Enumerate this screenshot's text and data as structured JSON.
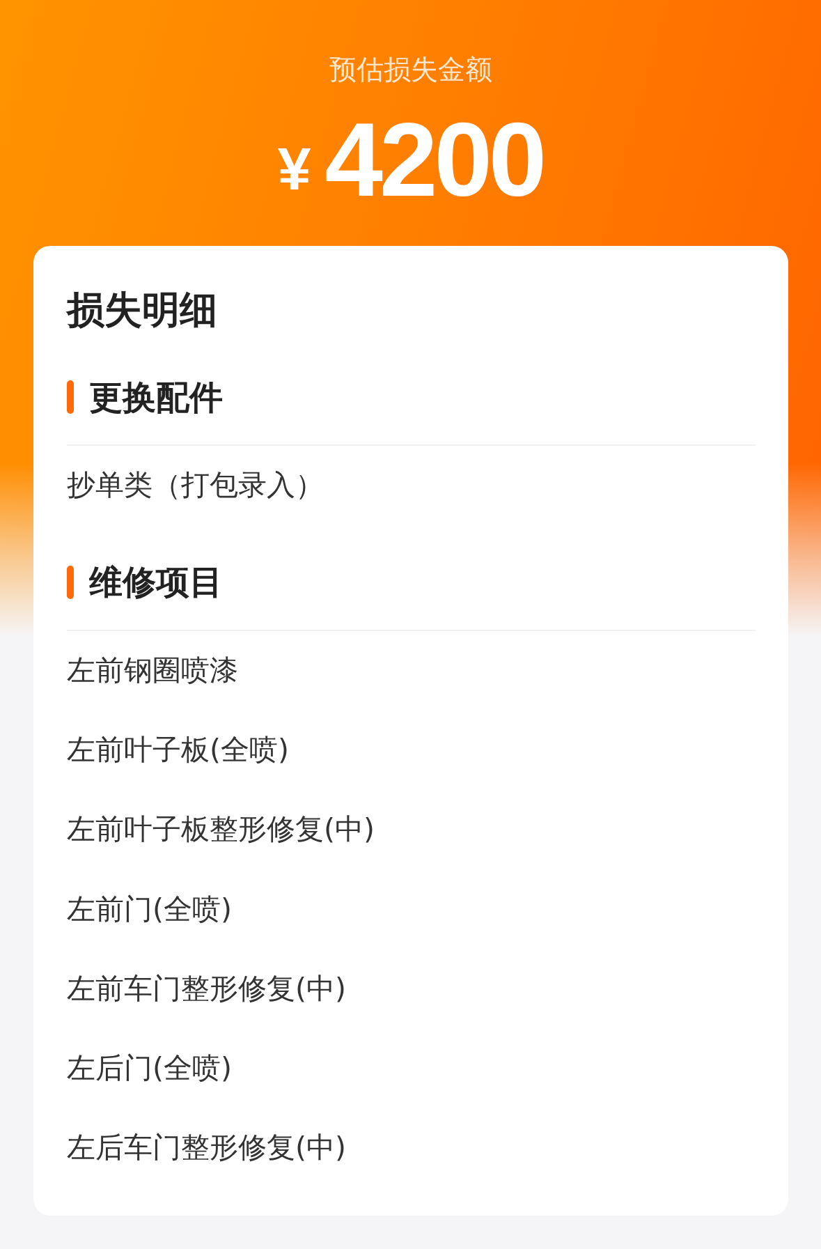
{
  "header": {
    "label": "预估损失金额",
    "currency": "¥",
    "amount": "4200"
  },
  "card": {
    "title": "损失明细",
    "sections": [
      {
        "title": "更换配件",
        "items": [
          "抄单类（打包录入）"
        ]
      },
      {
        "title": "维修项目",
        "items": [
          "左前钢圈喷漆",
          "左前叶子板(全喷)",
          "左前叶子板整形修复(中)",
          "左前门(全喷)",
          "左前车门整形修复(中)",
          "左后门(全喷)",
          "左后车门整形修复(中)"
        ]
      }
    ]
  }
}
